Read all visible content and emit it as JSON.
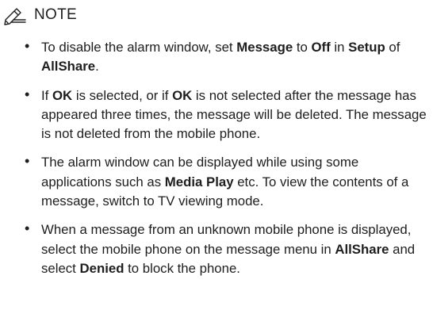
{
  "note": {
    "icon": "pencil-icon",
    "title": "NOTE"
  },
  "items": [
    [
      {
        "t": "To disable the alarm window, set ",
        "b": false
      },
      {
        "t": "Message",
        "b": true
      },
      {
        "t": " to ",
        "b": false
      },
      {
        "t": "Off",
        "b": true
      },
      {
        "t": " in ",
        "b": false
      },
      {
        "t": "Setup",
        "b": true
      },
      {
        "t": " of ",
        "b": false
      },
      {
        "t": "AllShare",
        "b": true
      },
      {
        "t": ".",
        "b": false
      }
    ],
    [
      {
        "t": "If ",
        "b": false
      },
      {
        "t": "OK",
        "b": true
      },
      {
        "t": " is selected, or if ",
        "b": false
      },
      {
        "t": "OK",
        "b": true
      },
      {
        "t": " is not selected after the message has appeared three times, the message will be deleted. The message is not deleted from the mobile phone.",
        "b": false
      }
    ],
    [
      {
        "t": "The alarm window can be displayed while using some applications such as ",
        "b": false
      },
      {
        "t": "Media Play",
        "b": true
      },
      {
        "t": " etc. To view the contents of a message, switch to TV viewing mode.",
        "b": false
      }
    ],
    [
      {
        "t": "When a message from an unknown mobile phone is displayed, select the mobile phone on the message menu in ",
        "b": false
      },
      {
        "t": "AllShare",
        "b": true
      },
      {
        "t": " and select ",
        "b": false
      },
      {
        "t": "Denied",
        "b": true
      },
      {
        "t": " to block the phone.",
        "b": false
      }
    ]
  ]
}
